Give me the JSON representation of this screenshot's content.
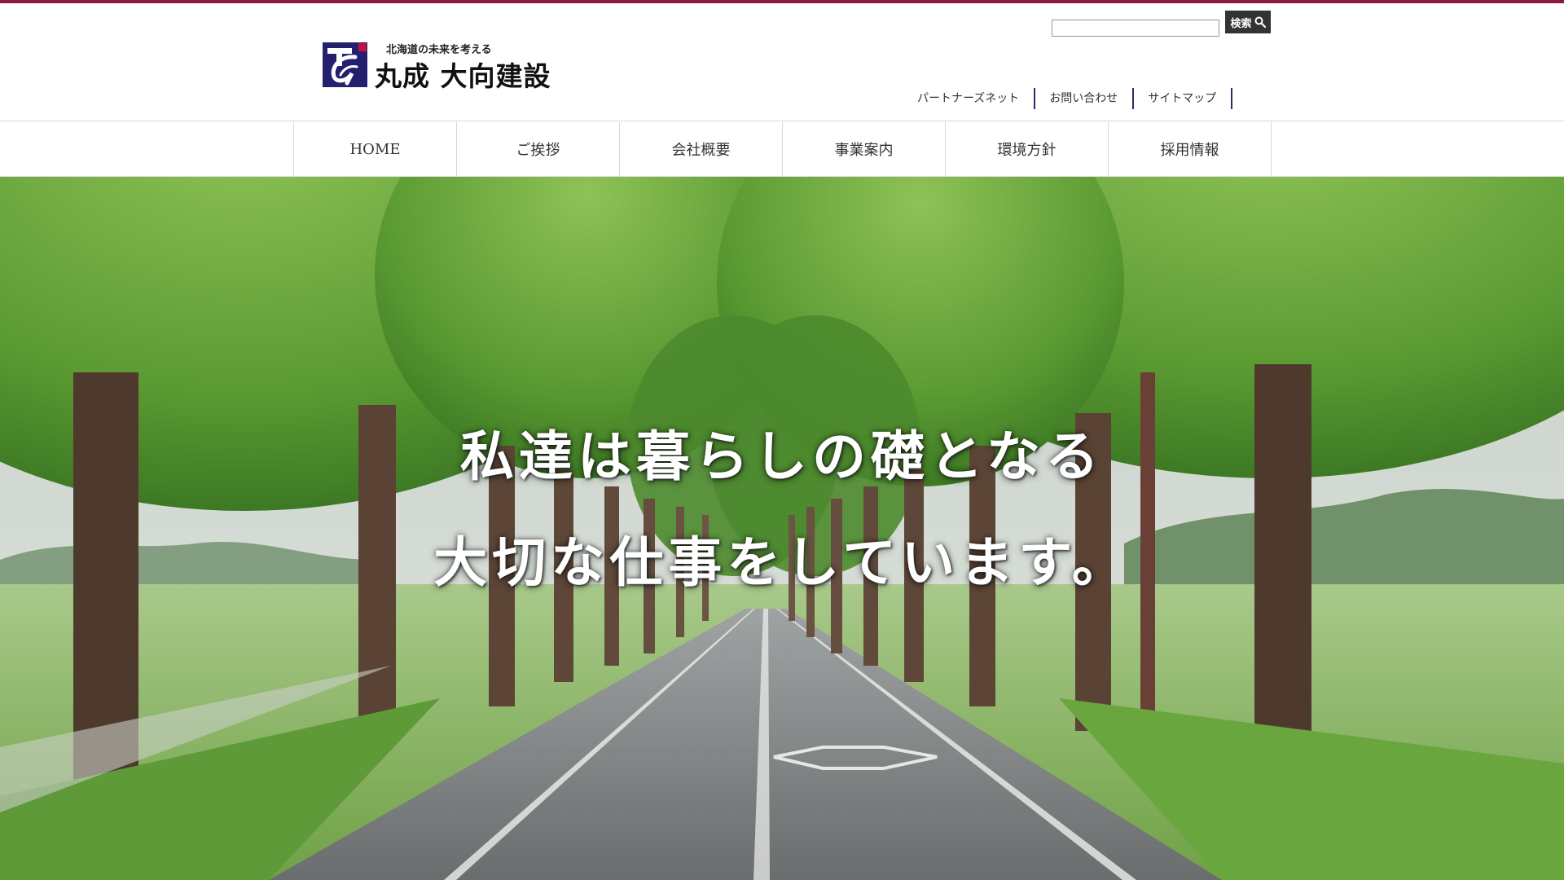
{
  "brand": {
    "tagline": "北海道の未来を考える",
    "name": "丸成 大向建設",
    "colors": {
      "accent": "#8a1b3d",
      "logo_navy": "#241f6e",
      "divider": "#2f2a6b"
    }
  },
  "search": {
    "placeholder": "",
    "value": "",
    "button_label": "検索",
    "button_icon": "magnifier-icon"
  },
  "utility_links": [
    "パートナーズネット",
    "お問い合わせ",
    "サイトマップ"
  ],
  "nav": {
    "items": [
      "HOME",
      "ご挨拶",
      "会社概要",
      "事業案内",
      "環境方針",
      "採用情報"
    ]
  },
  "hero": {
    "line1": "私達は暮らしの礎となる",
    "line2": "大切な仕事をしています。",
    "image": "tree-lined-road-photo"
  }
}
